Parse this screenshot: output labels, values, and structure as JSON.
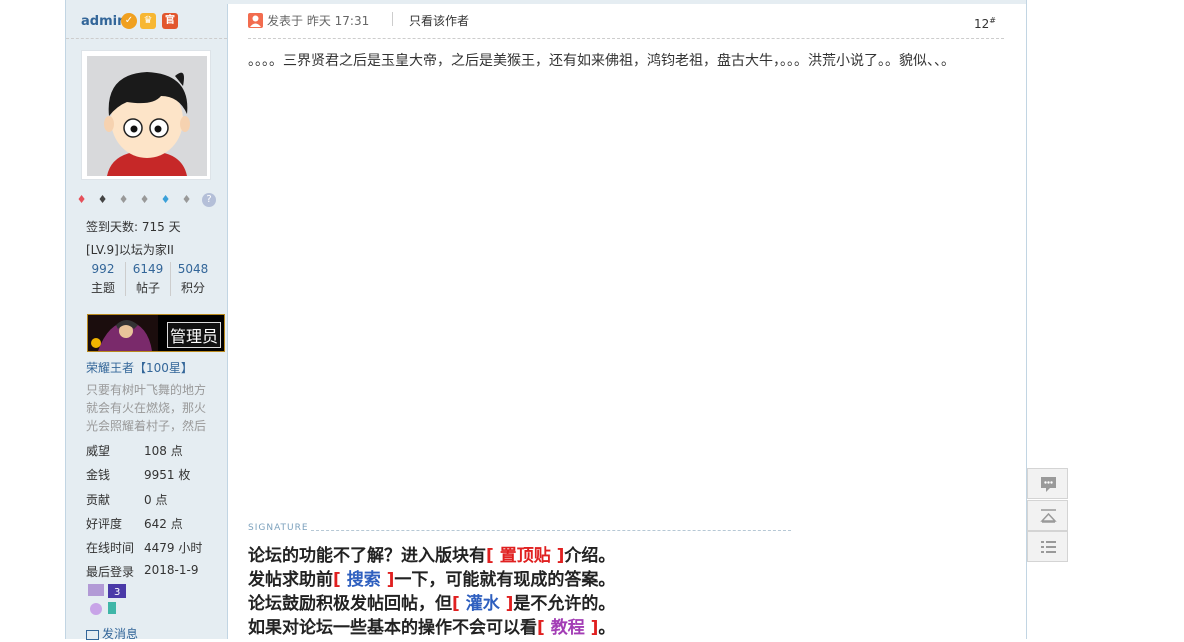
{
  "sidebar": {
    "username": "admin",
    "signin_days": "签到天数: 715 天",
    "level": "[LV.9]以坛为家II",
    "stats": [
      {
        "value": "992",
        "label": "主题"
      },
      {
        "value": "6149",
        "label": "帖子"
      },
      {
        "value": "5048",
        "label": "积分"
      }
    ],
    "badge_label": "管理员",
    "honor": "荣耀王者【100星】",
    "intro": "只要有树叶飞舞的地方就会有火在燃烧，那火光会照耀着村子，然后",
    "fields": [
      {
        "key": "威望",
        "value": "108 点"
      },
      {
        "key": "金钱",
        "value": "9951 枚"
      },
      {
        "key": "贡献",
        "value": "0 点"
      },
      {
        "key": "好评度",
        "value": "642 点"
      },
      {
        "key": "在线时间",
        "value": "4479 小时"
      },
      {
        "key": "最后登录",
        "value": "2018-1-9"
      }
    ],
    "pm": "发消息"
  },
  "post": {
    "posted": "发表于  昨天 17:31",
    "only_author": "只看该作者",
    "floor": "12",
    "floor_sup": "#",
    "content": "。。。。三界贤君之后是玉皇大帝，之后是美猴王，还有如来佛祖，鸿钧老祖，盘古大牛，。。。洪荒小说了。。貌似、、。"
  },
  "signature": {
    "label": "SIGNATURE",
    "lines": [
      {
        "pre": "论坛的功能不了解？进入版块有",
        "lb": "[ ",
        "link": "置顶贴",
        "rb": " ]",
        "post": "介绍。"
      },
      {
        "pre": "发帖求助前",
        "lb": "[ ",
        "link": "搜索",
        "rb": " ]",
        "post": "一下，可能就有现成的答案。"
      },
      {
        "pre": "论坛鼓励积极发帖回帖，但",
        "lb": "[ ",
        "link": "灌水",
        "rb": " ]",
        "post": "是不允许的。"
      },
      {
        "pre": "如果对论坛一些基本的操作不会可以看",
        "lb": "[ ",
        "link": "教程",
        "rb": " ]",
        "post": "。"
      }
    ]
  },
  "colors": {
    "accent": "#336699",
    "sidebar_bg": "#e5edf2",
    "sig_red": "#e02020",
    "sig_blue": "#2e5fbf",
    "sig_purple": "#a33db5"
  },
  "icons": [
    "verified-icon",
    "crown-icon",
    "admin-badge-icon",
    "medal-icons",
    "reply-icon",
    "back-to-top-icon",
    "list-icon"
  ]
}
